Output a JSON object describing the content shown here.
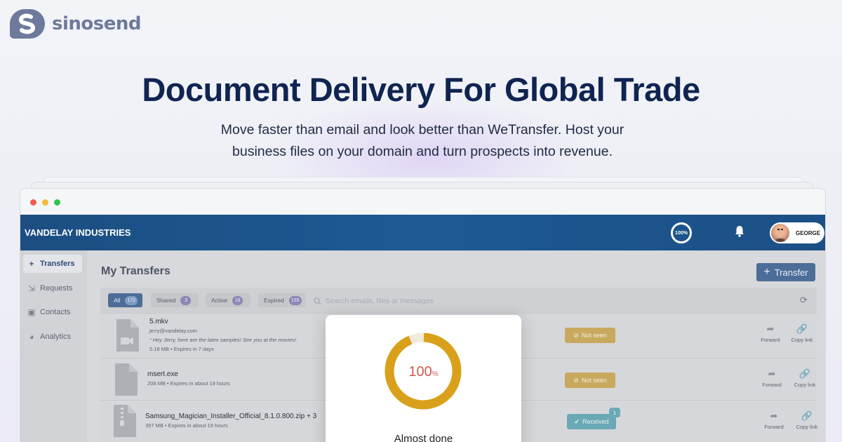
{
  "brand": {
    "name": "sinosend",
    "logo_icon": "sinosend-logo-icon"
  },
  "hero": {
    "title": "Document Delivery For Global Trade",
    "subtitle_line1": "Move faster than email and look better than WeTransfer. Host your",
    "subtitle_line2": "business files on your domain and turn prospects into revenue."
  },
  "app": {
    "company": "VANDELAY INDUSTRIES",
    "progress_label": "100%",
    "user_name": "GEORGE",
    "accent_color": "#1d5a93",
    "sidebar": [
      {
        "label": "Transfers",
        "icon": "plus-icon",
        "active": true
      },
      {
        "label": "Requests",
        "icon": "request-icon",
        "active": false
      },
      {
        "label": "Contacts",
        "icon": "contacts-icon",
        "active": false
      },
      {
        "label": "Analytics",
        "icon": "pie-chart-icon",
        "active": false
      }
    ],
    "page_title": "My Transfers",
    "transfer_button": "Transfer",
    "filters": [
      {
        "label": "All",
        "count": "172"
      },
      {
        "label": "Shared",
        "count": "3"
      },
      {
        "label": "Active",
        "count": "18"
      },
      {
        "label": "Expired",
        "count": "155"
      }
    ],
    "search_placeholder": "Search emails, files or messages",
    "transfers": [
      {
        "name": "5.mkv",
        "email": "jerry@vandelay.com",
        "message": "Hey Jerry, here are the latex samples! See you at the movies!",
        "meta": "5.18 MB • Expires in 7 days",
        "status": "Not seen",
        "file_icon": "video-file-icon"
      },
      {
        "name": "msert.exe",
        "meta": "208 MB • Expires in about 19 hours",
        "status": "Not seen",
        "file_icon": "file-icon"
      },
      {
        "name": "Samsung_Magician_Installer_Official_8.1.0.800.zip + 3",
        "meta": "397 MB • Expires in about 19 hours",
        "status": "Received",
        "status_count": "1",
        "file_icon": "zip-file-icon"
      }
    ],
    "actions": {
      "forward": "Forward",
      "copy_link": "Copy link"
    },
    "modal": {
      "progress": 100,
      "progress_value": "100",
      "progress_unit": "%",
      "status_text": "Almost done",
      "ring_color": "#d9a11b"
    }
  }
}
